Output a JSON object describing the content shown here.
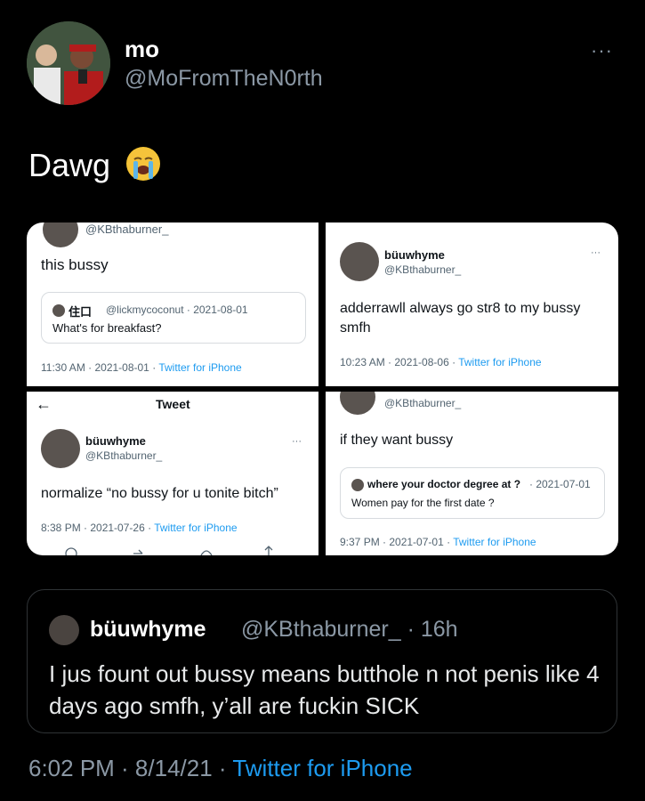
{
  "tweet": {
    "name": "mo",
    "handle": "@MoFromTheN0rth",
    "more": "···",
    "text": "Dawg",
    "emoji": "loudly-crying-face",
    "timestamp": "6:02 PM · 8/14/21 ·",
    "source": "Twitter for iPhone"
  },
  "screens": {
    "s1": {
      "handle": "@KBthaburner_",
      "text": "this bussy",
      "quote_user": "住口",
      "quote_handle_date": "@lickmycoconut · 2021-08-01",
      "quote_text": "What's for breakfast?",
      "meta": "11:30 AM · 2021-08-01 ·",
      "source": "Twitter for iPhone"
    },
    "s2": {
      "name": "büuwhyme",
      "handle": "@KBthaburner_",
      "more": "···",
      "text": "adderrawll always go str8 to my bussy smfh",
      "meta": "10:23 AM · 2021-08-06 ·",
      "source": "Twitter for iPhone"
    },
    "s3": {
      "back": "←",
      "header": "Tweet",
      "name": "büuwhyme",
      "handle": "@KBthaburner_",
      "more": "···",
      "text": "normalize “no bussy for u tonite bitch”",
      "meta": "8:38 PM · 2021-07-26 ·",
      "source": "Twitter for iPhone"
    },
    "s4": {
      "handle": "@KBthaburner_",
      "text": "if they want bussy",
      "quote_user": "where your doctor degree at ?",
      "quote_date": "· 2021-07-01",
      "quote_text": "Women pay for the first date ?",
      "meta": "9:37 PM · 2021-07-01 ·",
      "source": "Twitter for iPhone"
    }
  },
  "quoted": {
    "name": "büuwhyme",
    "handle_time": "@KBthaburner_ · 16h",
    "text": "I jus fount out bussy means butthole n not penis like 4 days ago smfh, y’all are fuckin SICK"
  }
}
